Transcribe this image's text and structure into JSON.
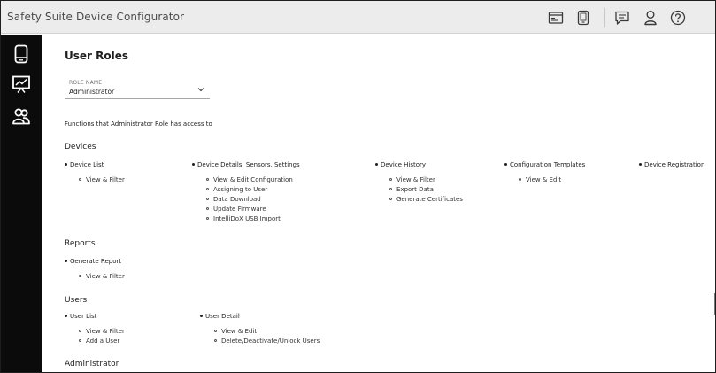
{
  "app": {
    "title": "Safety Suite Device Configurator"
  },
  "header": {
    "icons": [
      {
        "name": "device-list-icon"
      },
      {
        "name": "device-check-icon"
      },
      {
        "name": "chat-icon"
      },
      {
        "name": "user-icon"
      },
      {
        "name": "help-icon"
      }
    ]
  },
  "sidebar": {
    "items": [
      {
        "name": "device-icon"
      },
      {
        "name": "presentation-report-icon"
      },
      {
        "name": "users-group-icon"
      }
    ]
  },
  "page": {
    "title": "User Roles"
  },
  "role": {
    "label": "ROLE NAME",
    "value": "Administrator"
  },
  "access_text": "Functions that Administrator Role has access to",
  "sections": {
    "devices": {
      "title": "Devices",
      "groups": [
        {
          "title": "Device List",
          "items": [
            "View & Filter"
          ]
        },
        {
          "title": "Device Details, Sensors, Settings",
          "items": [
            "View & Edit Configuration",
            "Assigning to User",
            "Data Download",
            "Update Firmware",
            "IntelliDoX USB Import"
          ]
        },
        {
          "title": "Device History",
          "items": [
            "View & Filter",
            "Export Data",
            "Generate Certificates"
          ]
        },
        {
          "title": "Configuration Templates",
          "items": [
            "View & Edit"
          ]
        },
        {
          "title": "Device Registration",
          "items": []
        }
      ]
    },
    "reports": {
      "title": "Reports",
      "groups": [
        {
          "title": "Generate Report",
          "items": [
            "View & Filter"
          ]
        }
      ]
    },
    "users": {
      "title": "Users",
      "groups": [
        {
          "title": "User List",
          "items": [
            "View & Filter",
            "Add a User"
          ]
        },
        {
          "title": "User Detail",
          "items": [
            "View & Edit",
            "Delete/Deactivate/Unlock Users"
          ]
        }
      ]
    },
    "administrator": {
      "title": "Administrator"
    }
  },
  "colors": {
    "header_bg": "#ececec",
    "sidebar_bg": "#0b0b0b",
    "text": "#222222"
  }
}
